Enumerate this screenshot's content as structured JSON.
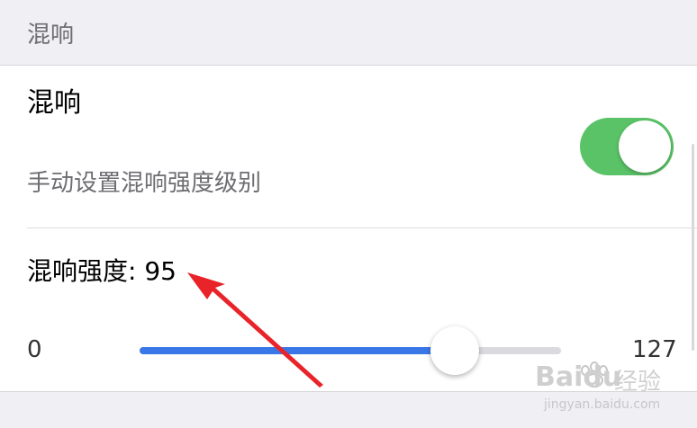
{
  "section_header": {
    "label": "混响"
  },
  "reverb": {
    "title": "混响",
    "subtitle": "手动设置混响强度级别",
    "enabled": true
  },
  "intensity": {
    "label": "混响强度: 95",
    "value": 95,
    "min_label": "0",
    "max_label": "127",
    "min": 0,
    "max": 127
  },
  "colors": {
    "toggle_on": "#5ac367",
    "slider_fill": "#3a77e6",
    "annotation_arrow": "#e8242a"
  },
  "watermark": {
    "brand": "Baidu",
    "cn": "经验",
    "url": "jingyan.baidu.com"
  }
}
